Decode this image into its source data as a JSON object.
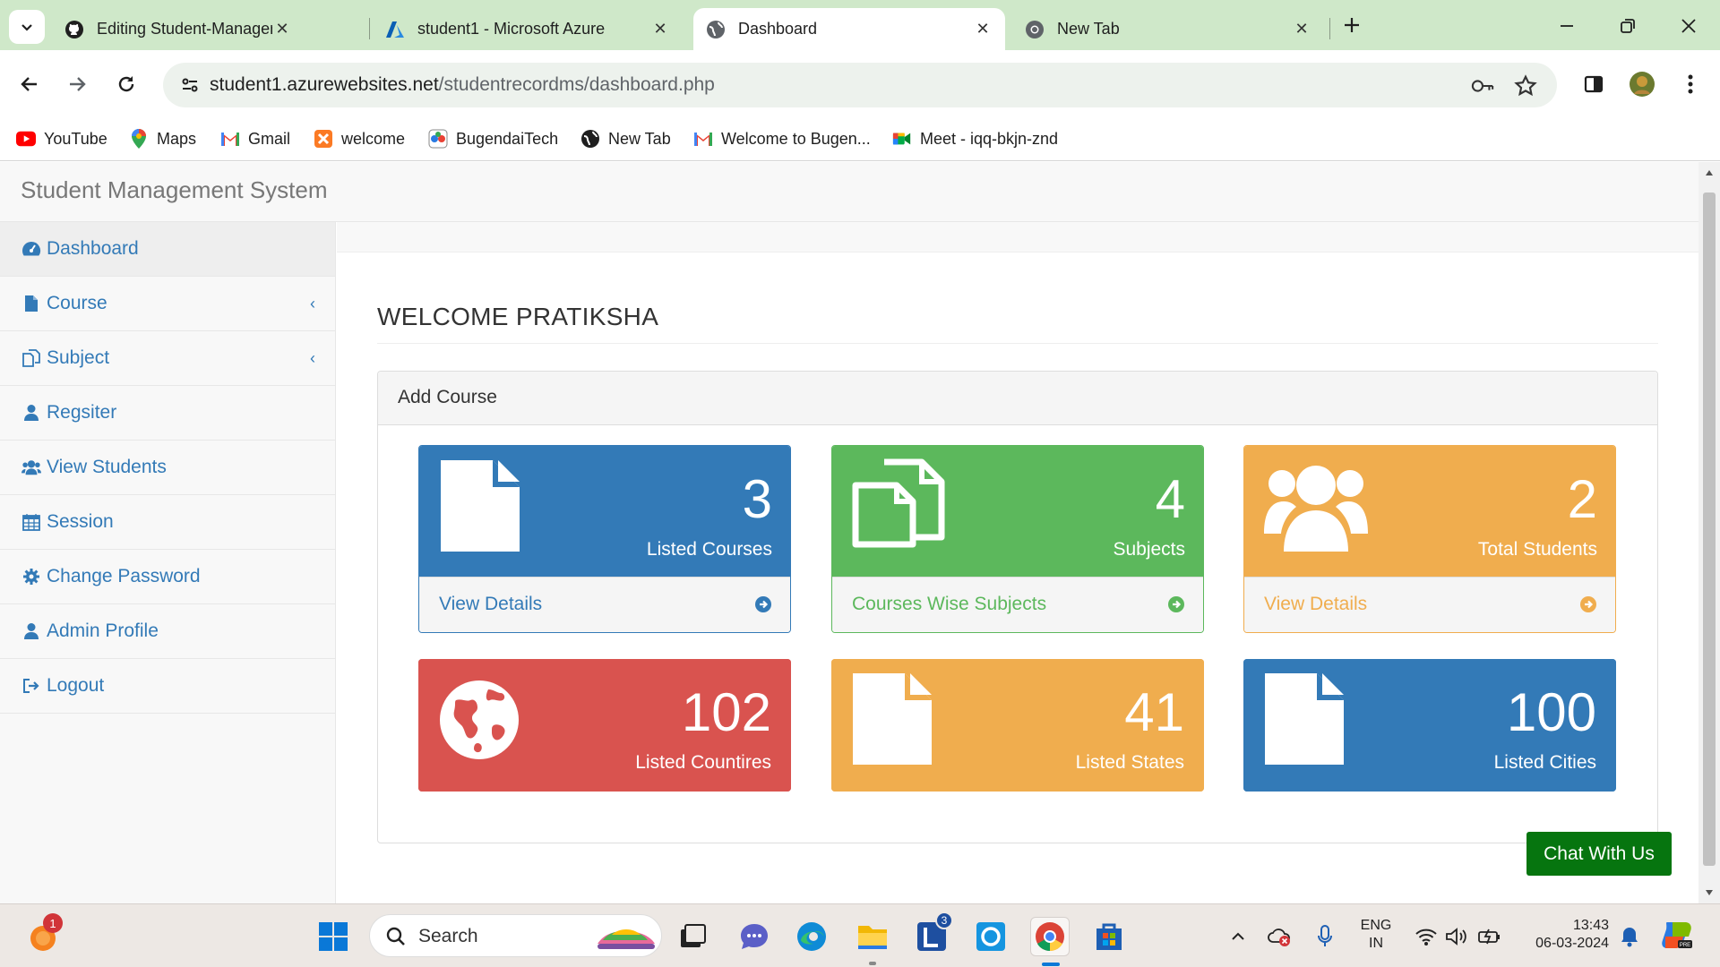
{
  "browser": {
    "tabs": [
      {
        "title": "Editing Student-Management-",
        "icon": "github-icon"
      },
      {
        "title": "student1 - Microsoft Azure",
        "icon": "azure-icon"
      },
      {
        "title": "Dashboard",
        "icon": "globe-icon",
        "active": true
      },
      {
        "title": "New Tab",
        "icon": "chrome-icon"
      }
    ],
    "url_host": "student1.azurewebsites.net",
    "url_path": "/studentrecordms/dashboard.php",
    "bookmarks": [
      {
        "label": "YouTube",
        "icon": "youtube-icon"
      },
      {
        "label": "Maps",
        "icon": "maps-icon"
      },
      {
        "label": "Gmail",
        "icon": "gmail-icon"
      },
      {
        "label": "welcome",
        "icon": "xampp-icon"
      },
      {
        "label": "BugendaiTech",
        "icon": "bugendai-icon"
      },
      {
        "label": "New Tab",
        "icon": "globe-icon"
      },
      {
        "label": "Welcome to Bugen...",
        "icon": "gmail-icon"
      },
      {
        "label": "Meet - iqq-bkjn-znd",
        "icon": "meet-icon"
      }
    ]
  },
  "app": {
    "brand": "Student Management System",
    "sidebar": [
      {
        "label": "Dashboard",
        "icon": "dashboard-icon",
        "active": true
      },
      {
        "label": "Course",
        "icon": "file-icon",
        "has_submenu": true
      },
      {
        "label": "Subject",
        "icon": "copy-icon",
        "has_submenu": true
      },
      {
        "label": "Regsiter",
        "icon": "user-icon"
      },
      {
        "label": "View Students",
        "icon": "users-icon"
      },
      {
        "label": "Session",
        "icon": "calendar-icon"
      },
      {
        "label": "Change Password",
        "icon": "cog-icon"
      },
      {
        "label": "Admin Profile",
        "icon": "user-icon"
      },
      {
        "label": "Logout",
        "icon": "sign-out-icon"
      }
    ],
    "welcome": "WELCOME PRATIKSHA",
    "panel_title": "Add Course",
    "cards": [
      {
        "count": "3",
        "label": "Listed Courses",
        "footer": "View Details",
        "color": "#337ab7",
        "icon": "file-icon"
      },
      {
        "count": "4",
        "label": "Subjects",
        "footer": "Courses Wise Subjects",
        "color": "#5cb85c",
        "icon": "copy-icon"
      },
      {
        "count": "2",
        "label": "Total Students",
        "footer": "View Details",
        "color": "#f0ad4e",
        "icon": "users-icon"
      },
      {
        "count": "102",
        "label": "Listed Countires",
        "color": "#d9534f",
        "icon": "globe-icon"
      },
      {
        "count": "41",
        "label": "Listed States",
        "color": "#f0ad4e",
        "icon": "file-icon"
      },
      {
        "count": "100",
        "label": "Listed Cities",
        "color": "#337ab7",
        "icon": "file-icon"
      }
    ],
    "chat_button": "Chat With Us"
  },
  "taskbar": {
    "search_placeholder": "Search",
    "notification_badge": "1",
    "lens_badge": "3",
    "lang_line1": "ENG",
    "lang_line2": "IN",
    "time": "13:43",
    "date": "06-03-2024"
  },
  "colors": {
    "primary": "#337ab7",
    "success": "#5cb85c",
    "warning": "#f0ad4e",
    "danger": "#d9534f",
    "chat": "#06750f"
  }
}
